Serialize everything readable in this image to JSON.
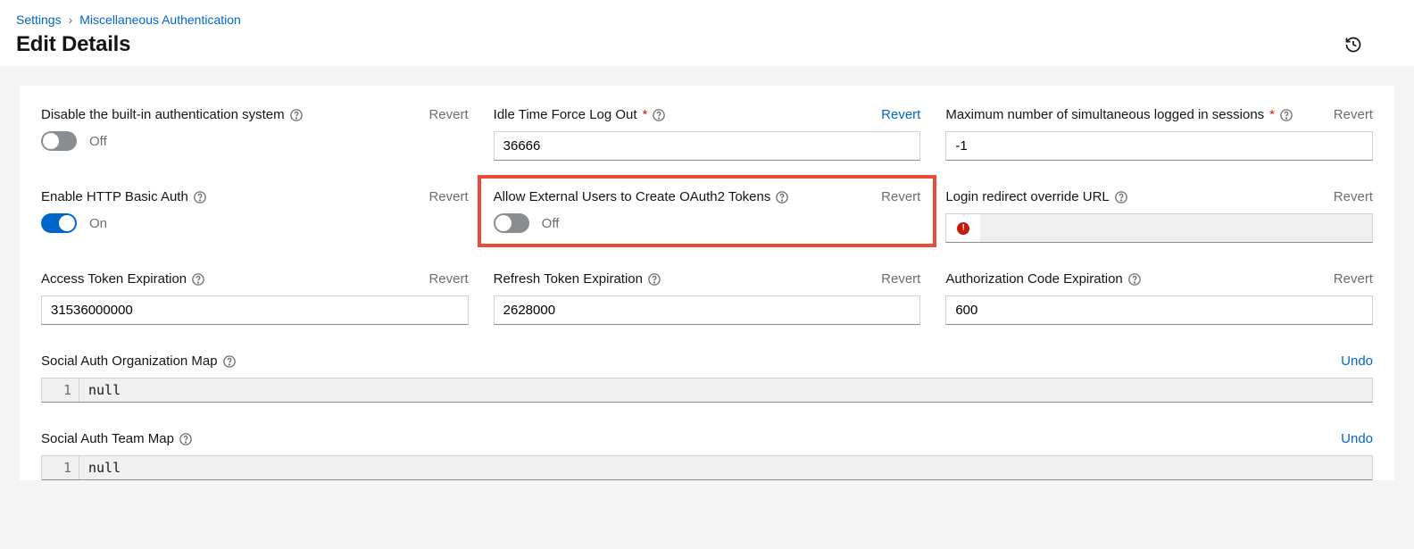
{
  "breadcrumb": {
    "settings": "Settings",
    "page": "Miscellaneous Authentication"
  },
  "page_title": "Edit Details",
  "labels": {
    "revert": "Revert",
    "undo": "Undo",
    "off": "Off",
    "on": "On"
  },
  "row1": {
    "disable_builtin": {
      "label": "Disable the built-in authentication system",
      "state": "Off"
    },
    "idle_time": {
      "label": "Idle Time Force Log Out",
      "value": "36666"
    },
    "max_sessions": {
      "label": "Maximum number of simultaneous logged in sessions",
      "value": "-1"
    }
  },
  "row2": {
    "basic_auth": {
      "label": "Enable HTTP Basic Auth",
      "state": "On"
    },
    "oauth_external": {
      "label": "Allow External Users to Create OAuth2 Tokens",
      "state": "Off"
    },
    "login_redirect": {
      "label": "Login redirect override URL",
      "value": ""
    }
  },
  "row3": {
    "access_token": {
      "label": "Access Token Expiration",
      "value": "31536000000"
    },
    "refresh_token": {
      "label": "Refresh Token Expiration",
      "value": "2628000"
    },
    "auth_code": {
      "label": "Authorization Code Expiration",
      "value": "600"
    }
  },
  "social_org": {
    "label": "Social Auth Organization Map",
    "code": "null"
  },
  "social_team": {
    "label": "Social Auth Team Map",
    "code": "null"
  }
}
